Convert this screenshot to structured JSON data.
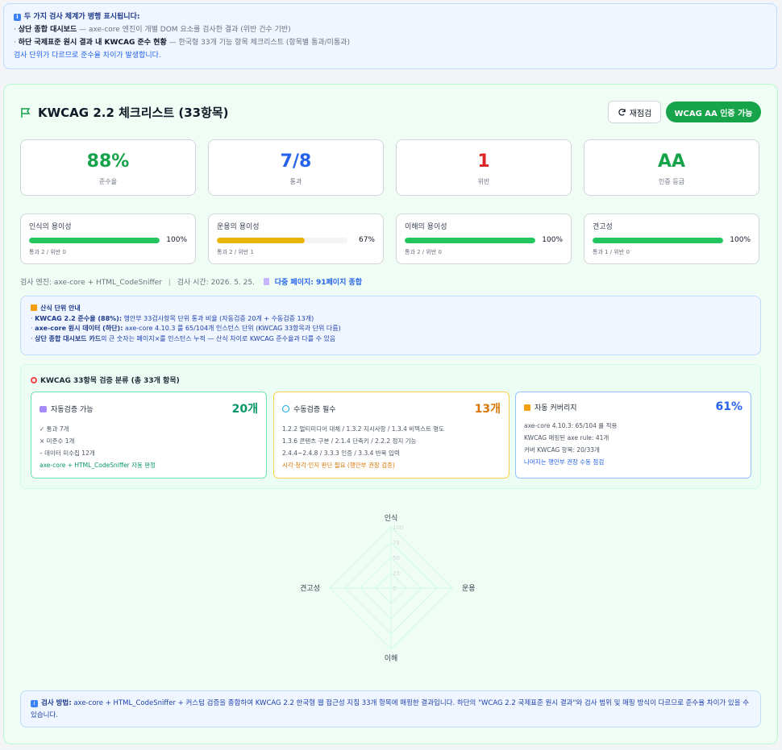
{
  "notice": {
    "title": "두 가지 검사 체계가 병행 표시됩니다:",
    "line1_bold": "상단 종합 대시보드",
    "line1_rest": " — axe-core 엔진이 개별 DOM 요소를 검사한 결과 (위반 건수 기반)",
    "line2_bold": "하단 국제표준 원시 결과 내 KWCAG 준수 현황",
    "line2_rest": " — 한국형 33개 기능 항목 체크리스트 (항목별 통과/미통과)",
    "line3": "검사 단위가 다르므로 준수율 차이가 발생합니다."
  },
  "header": {
    "title": "KWCAG 2.2 체크리스트 (33항목)",
    "recheck_label": "재점검",
    "cert_label": "WCAG AA 인증 가능"
  },
  "stats": [
    {
      "value": "88%",
      "label": "준수율",
      "color": "#16a34a"
    },
    {
      "value": "7/8",
      "label": "통과",
      "color": "#2563eb"
    },
    {
      "value": "1",
      "label": "위반",
      "color": "#dc2626"
    },
    {
      "value": "AA",
      "label": "인증 등급",
      "color": "#16a34a"
    }
  ],
  "categories": [
    {
      "name": "인식의 용이성",
      "pct_text": "100%",
      "level": 1.0,
      "sub": "통과 2 / 위반 0",
      "color": "#22c55e"
    },
    {
      "name": "운용의 용이성",
      "pct_text": "67%",
      "level": 0.67,
      "sub": "통과 2 / 위반 1",
      "color": "#eab308"
    },
    {
      "name": "이해의 용이성",
      "pct_text": "100%",
      "level": 1.0,
      "sub": "통과 2 / 위반 0",
      "color": "#22c55e"
    },
    {
      "name": "견고성",
      "pct_text": "100%",
      "level": 1.0,
      "sub": "통과 1 / 위반 0",
      "color": "#22c55e"
    }
  ],
  "meta": {
    "engine": "검사 엔진: axe-core + HTML_CodeSniffer",
    "sep": "|",
    "time": "검사 시간: 2026. 5. 25.",
    "pages": "다중 페이지: 91페이지 종합"
  },
  "guide": {
    "title": "산식 단위 안내",
    "l1b": "KWCAG 2.2 준수율 (88%):",
    "l1": " 행안부 33검사항목 단위 통과 비율 (자동검증 20개 + 수동검증 13개)",
    "l2b": "axe-core 원시 데이터 (하단):",
    "l2": " axe-core 4.10.3 룰 65/104개 인스턴스 단위 (KWCAG 33항목과 단위 다름)",
    "l3b": "상단 종합 대시보드 카드",
    "l3": "의 큰 숫자는 페이지×룰 인스턴스 누적 — 산식 차이로 KWCAG 준수율과 다를 수 있음"
  },
  "classification": {
    "title": "KWCAG 33항목 검증 분류 (총 33개 항목)",
    "cards": [
      {
        "name": "자동검증 가능",
        "count": "20개",
        "items": [
          "✓ 통과 7개",
          "× 미준수 1개",
          "– 데이터 미수집 12개"
        ],
        "foot": "axe-core + HTML_CodeSniffer 자동 판정",
        "color": "#059669",
        "border": "#6ee7b7"
      },
      {
        "name": "수동검증 필수",
        "count": "13개",
        "items": [
          "1.2.2 멀티미디어 대체 / 1.3.2 지시사항 / 1.3.4 비텍스트 명도",
          "1.3.6 콘텐츠 구분 / 2.1.4 단축키 / 2.2.2 정지 기능",
          "2.4.4~2.4.8 / 3.3.3 인증 / 3.3.4 반복 입력"
        ],
        "foot": "시각·청각·인지 판단 필요 (행안부 권장 검증)",
        "color": "#d97706",
        "border": "#fcd34d"
      },
      {
        "name": "자동 커버리지",
        "count": "61%",
        "items": [
          "axe-core 4.10.3: 65/104 룰 적용",
          "KWCAG 매핑된 axe rule: 41개",
          "커버 KWCAG 항목: 20/33개"
        ],
        "foot": "나머지는 행안부 권장 수동 점검",
        "color": "#2563eb",
        "border": "#93c5fd"
      }
    ]
  },
  "chart_data": {
    "type": "radar",
    "categories": [
      "인식",
      "운용",
      "이해",
      "견고성"
    ],
    "values": [
      0,
      0,
      0,
      0
    ],
    "rlim": [
      0,
      100
    ],
    "ticks": [
      "0",
      "25",
      "50",
      "75",
      "100"
    ]
  },
  "method": {
    "bold": "검사 방법:",
    "text": " axe-core + HTML_CodeSniffer + 커스텀 검증을 종합하여 KWCAG 2.2 한국형 웹 접근성 지침 33개 항목에 매핑한 결과입니다. 하단의 \"WCAG 2.2 국제표준 원시 결과\"와 검사 범위 및 매핑 방식이 다르므로 준수율 차이가 있을 수 있습니다."
  }
}
